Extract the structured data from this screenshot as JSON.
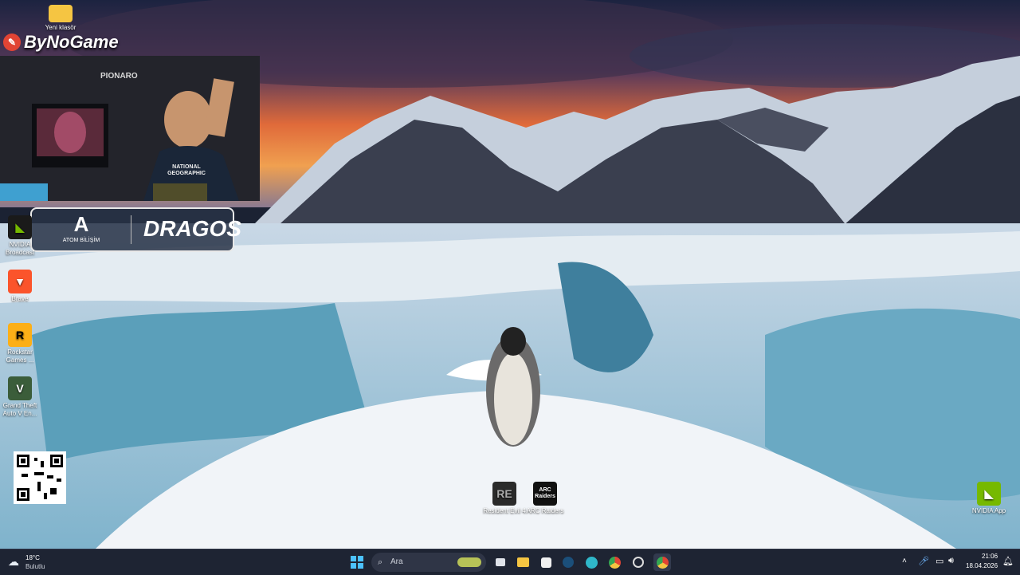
{
  "colors": {
    "taskbar": "#1e2433",
    "accent": "#e14434",
    "sky_top": "#1c2340",
    "sky_orange": "#f08a3c"
  },
  "overlay": {
    "channel_name": "ByNoGame",
    "sponsor_1": "ATOM BİLİŞİM",
    "sponsor_2": "DRAGOS",
    "shirt_text": "NATIONAL GEOGRAPHIC",
    "wall_sign": "PIONARO"
  },
  "desktop_icons": {
    "top_folder": "Yeni klasör",
    "nvidia_broadcast": "NVIDIA Broadcast",
    "brave": "Brave",
    "rockstar": "Rockstar Games ...",
    "gta": "Grand Theft Auto V En...",
    "resident_evil": "Resident Evil 4",
    "arc_raiders": "ARC Raiders",
    "arc_tile_text": "ARC Raiders",
    "nvidia_app": "NVIDIA App"
  },
  "weather": {
    "temp": "18°C",
    "condition": "Bulutlu"
  },
  "search": {
    "placeholder": "Ara"
  },
  "clock": {
    "time": "21:06",
    "date": "18.04.2026"
  }
}
